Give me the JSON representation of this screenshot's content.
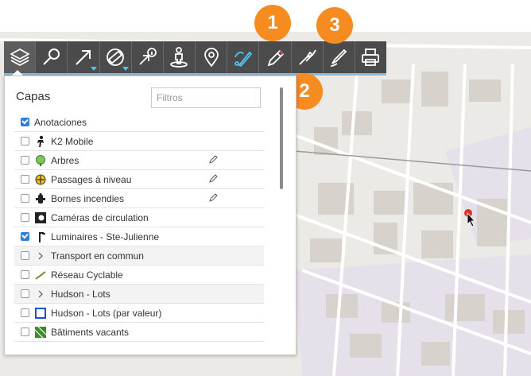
{
  "toolbar": {
    "buttons": [
      {
        "name": "layers-icon"
      },
      {
        "name": "search-icon"
      },
      {
        "name": "arrow-icon"
      },
      {
        "name": "measure-icon"
      },
      {
        "name": "info-arrow-icon"
      },
      {
        "name": "street-view-icon"
      },
      {
        "name": "location-pin-icon"
      },
      {
        "name": "draw-tool-icon"
      },
      {
        "name": "pencil-icon"
      },
      {
        "name": "markers-icon"
      },
      {
        "name": "pen-icon"
      },
      {
        "name": "print-icon"
      }
    ]
  },
  "badges": [
    "1",
    "2",
    "3"
  ],
  "layers_panel": {
    "title": "Capas",
    "filter_placeholder": "Filtros",
    "rows": [
      {
        "label": "Anotaciones",
        "checked": true,
        "icon": "none"
      },
      {
        "label": "K2 Mobile",
        "checked": false,
        "icon": "person-icon"
      },
      {
        "label": "Arbres",
        "checked": false,
        "icon": "tree-icon",
        "editable": true
      },
      {
        "label": "Passages à niveau",
        "checked": false,
        "icon": "crossing-icon",
        "editable": true
      },
      {
        "label": "Bornes incendies",
        "checked": false,
        "icon": "hydrant-icon",
        "editable": true
      },
      {
        "label": "Caméras de circulation",
        "checked": false,
        "icon": "camera-icon"
      },
      {
        "label": "Luminaires - Ste-Julienne",
        "checked": true,
        "icon": "streetlight-icon"
      },
      {
        "label": "Transport en commun",
        "checked": false,
        "icon": "chevron-icon",
        "shade": true
      },
      {
        "label": "Réseau Cyclable",
        "checked": false,
        "icon": "bike-lane-icon"
      },
      {
        "label": "Hudson - Lots",
        "checked": false,
        "icon": "chevron-icon",
        "shade": true
      },
      {
        "label": "Hudson - Lots (par valeur)",
        "checked": false,
        "icon": "square-outline-icon"
      },
      {
        "label": "Bâtiments vacants",
        "checked": false,
        "icon": "hatched-square-icon"
      }
    ]
  },
  "colors": {
    "toolbar_bg": "#4b4b4b",
    "badge": "#f68b1f",
    "checkbox_checked": "#2f7fe0",
    "active_tool": "#4fc3f7"
  }
}
